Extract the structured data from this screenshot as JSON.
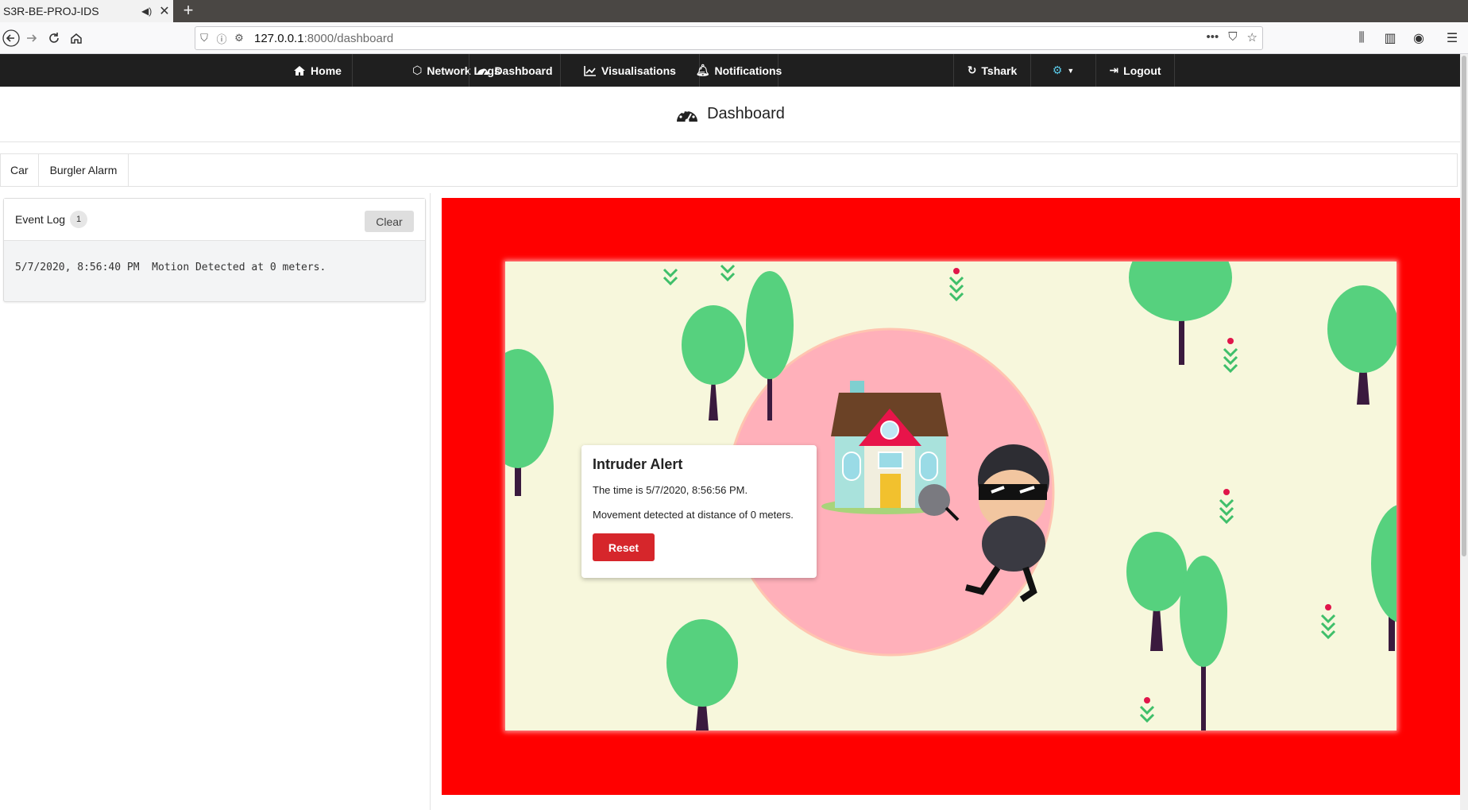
{
  "browser": {
    "tab_title": "S3R-BE-PROJ-IDS",
    "tab_audio_icon": "speaker-icon",
    "tab_close_icon": "close-icon",
    "new_tab_label": "+",
    "url_host": "127.0.0.1",
    "url_path": ":8000/dashboard"
  },
  "nav": {
    "items": [
      {
        "label": "Home",
        "icon": "home-icon"
      },
      {
        "label": "Network Logs",
        "icon": "network-icon"
      },
      {
        "label": "Dashboard",
        "icon": "dashboard-icon"
      },
      {
        "label": "Visualisations",
        "icon": "chart-icon"
      },
      {
        "label": "Notifications",
        "icon": "bell-icon"
      },
      {
        "label": "Tshark",
        "icon": "refresh-icon"
      },
      {
        "label": "",
        "icon": "gear-icon"
      },
      {
        "label": "Logout",
        "icon": "logout-icon"
      }
    ]
  },
  "page": {
    "title": "Dashboard",
    "title_icon": "tachometer-icon"
  },
  "subtabs": [
    "Car",
    "Burgler Alarm"
  ],
  "event_log": {
    "title": "Event Log",
    "count": "1",
    "clear_label": "Clear",
    "entries": [
      "5/7/2020, 8:56:40 PM  Motion Detected at 0 meters."
    ]
  },
  "alert": {
    "title": "Intruder Alert",
    "time_text": "The time is 5/7/2020, 8:56:56 PM.",
    "movement_text": "Movement detected at distance of 0 meters.",
    "reset_label": "Reset",
    "reset_color": "#d6262b",
    "panel_color": "#ff0000"
  }
}
